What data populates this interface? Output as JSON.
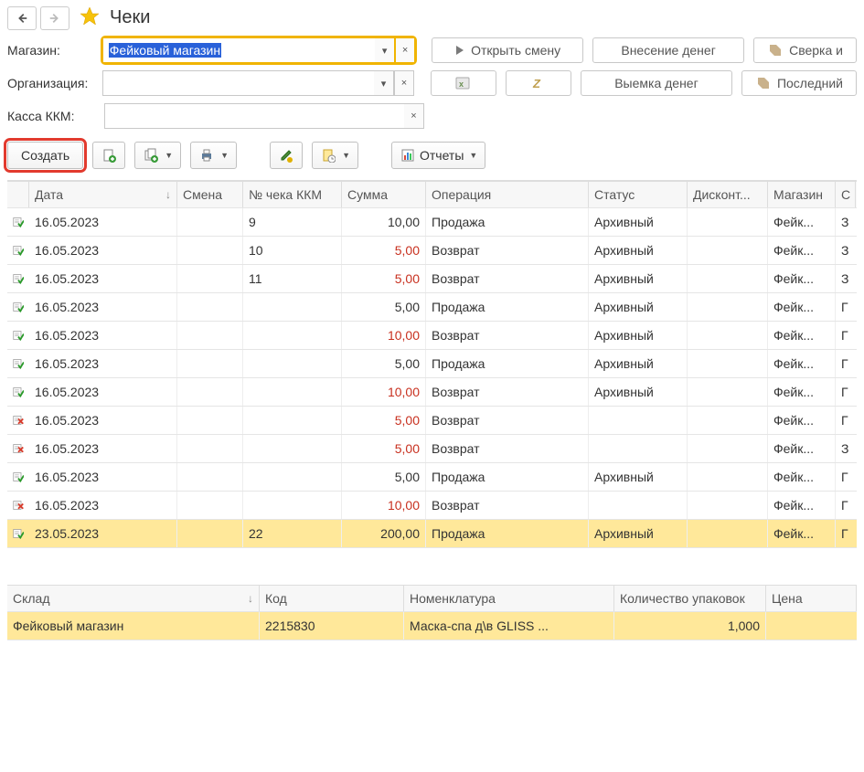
{
  "title": "Чеки",
  "filters": {
    "store_label": "Магазин:",
    "store_value": "Фейковый магазин",
    "org_label": "Организация:",
    "org_value": "",
    "kkm_label": "Касса ККМ:",
    "kkm_value": ""
  },
  "top_buttons": {
    "open_shift": "Открыть смену",
    "deposit": "Внесение денег",
    "withdraw": "Выемка денег",
    "recon": "Сверка и",
    "last": "Последний"
  },
  "toolbar": {
    "create": "Создать",
    "reports": "Отчеты"
  },
  "grid": {
    "headers": {
      "date": "Дата",
      "shift": "Смена",
      "num": "№ чека ККМ",
      "sum": "Сумма",
      "op": "Операция",
      "status": "Статус",
      "discount": "Дисконт...",
      "store": "Магазин",
      "last": "С"
    },
    "rows": [
      {
        "icon": "ok",
        "date": "16.05.2023",
        "shift": "",
        "num": "9",
        "sum": "10,00",
        "red": false,
        "op": "Продажа",
        "status": "Архивный",
        "disc": "",
        "store": "Фейк...",
        "last": "З"
      },
      {
        "icon": "ok",
        "date": "16.05.2023",
        "shift": "",
        "num": "10",
        "sum": "5,00",
        "red": true,
        "op": "Возврат",
        "status": "Архивный",
        "disc": "",
        "store": "Фейк...",
        "last": "З"
      },
      {
        "icon": "ok",
        "date": "16.05.2023",
        "shift": "",
        "num": "11",
        "sum": "5,00",
        "red": true,
        "op": "Возврат",
        "status": "Архивный",
        "disc": "",
        "store": "Фейк...",
        "last": "З"
      },
      {
        "icon": "ok",
        "date": "16.05.2023",
        "shift": "",
        "num": "",
        "sum": "5,00",
        "red": false,
        "op": "Продажа",
        "status": "Архивный",
        "disc": "",
        "store": "Фейк...",
        "last": "Г"
      },
      {
        "icon": "ok",
        "date": "16.05.2023",
        "shift": "",
        "num": "",
        "sum": "10,00",
        "red": true,
        "op": "Возврат",
        "status": "Архивный",
        "disc": "",
        "store": "Фейк...",
        "last": "Г"
      },
      {
        "icon": "ok",
        "date": "16.05.2023",
        "shift": "",
        "num": "",
        "sum": "5,00",
        "red": false,
        "op": "Продажа",
        "status": "Архивный",
        "disc": "",
        "store": "Фейк...",
        "last": "Г"
      },
      {
        "icon": "ok",
        "date": "16.05.2023",
        "shift": "",
        "num": "",
        "sum": "10,00",
        "red": true,
        "op": "Возврат",
        "status": "Архивный",
        "disc": "",
        "store": "Фейк...",
        "last": "Г"
      },
      {
        "icon": "del",
        "date": "16.05.2023",
        "shift": "",
        "num": "",
        "sum": "5,00",
        "red": true,
        "op": "Возврат",
        "status": "",
        "disc": "",
        "store": "Фейк...",
        "last": "Г"
      },
      {
        "icon": "del",
        "date": "16.05.2023",
        "shift": "",
        "num": "",
        "sum": "5,00",
        "red": true,
        "op": "Возврат",
        "status": "",
        "disc": "",
        "store": "Фейк...",
        "last": "З"
      },
      {
        "icon": "ok",
        "date": "16.05.2023",
        "shift": "",
        "num": "",
        "sum": "5,00",
        "red": false,
        "op": "Продажа",
        "status": "Архивный",
        "disc": "",
        "store": "Фейк...",
        "last": "Г"
      },
      {
        "icon": "del",
        "date": "16.05.2023",
        "shift": "",
        "num": "",
        "sum": "10,00",
        "red": true,
        "op": "Возврат",
        "status": "",
        "disc": "",
        "store": "Фейк...",
        "last": "Г"
      },
      {
        "icon": "ok",
        "date": "23.05.2023",
        "shift": "",
        "num": "22",
        "sum": "200,00",
        "red": false,
        "op": "Продажа",
        "status": "Архивный",
        "disc": "",
        "store": "Фейк...",
        "last": "Г",
        "selected": true
      }
    ]
  },
  "grid2": {
    "headers": {
      "wh": "Склад",
      "code": "Код",
      "nom": "Номенклатура",
      "qty": "Количество упаковок",
      "price": "Цена"
    },
    "rows": [
      {
        "wh": "Фейковый магазин",
        "code": "2215830",
        "nom": "Маска-спа д\\в GLISS ...",
        "qty": "1,000",
        "price": "",
        "selected": true
      }
    ]
  }
}
